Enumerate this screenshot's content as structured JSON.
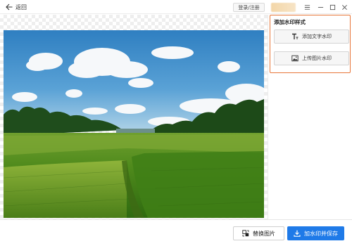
{
  "titlebar": {
    "back_label": "返回",
    "login_label": "登录/注册"
  },
  "panel": {
    "title": "添加水印样式",
    "buttons": [
      {
        "label": "添加文字水印",
        "icon": "text-icon"
      },
      {
        "label": "上传图片水印",
        "icon": "image-icon"
      }
    ],
    "highlight_color": "#e8773a"
  },
  "bottom": {
    "replace_label": "替换图片",
    "save_label": "加水印并保存",
    "accent_color": "#1f7ae8"
  },
  "canvas": {
    "image_subject": "green rice field under blue sky with clouds"
  }
}
